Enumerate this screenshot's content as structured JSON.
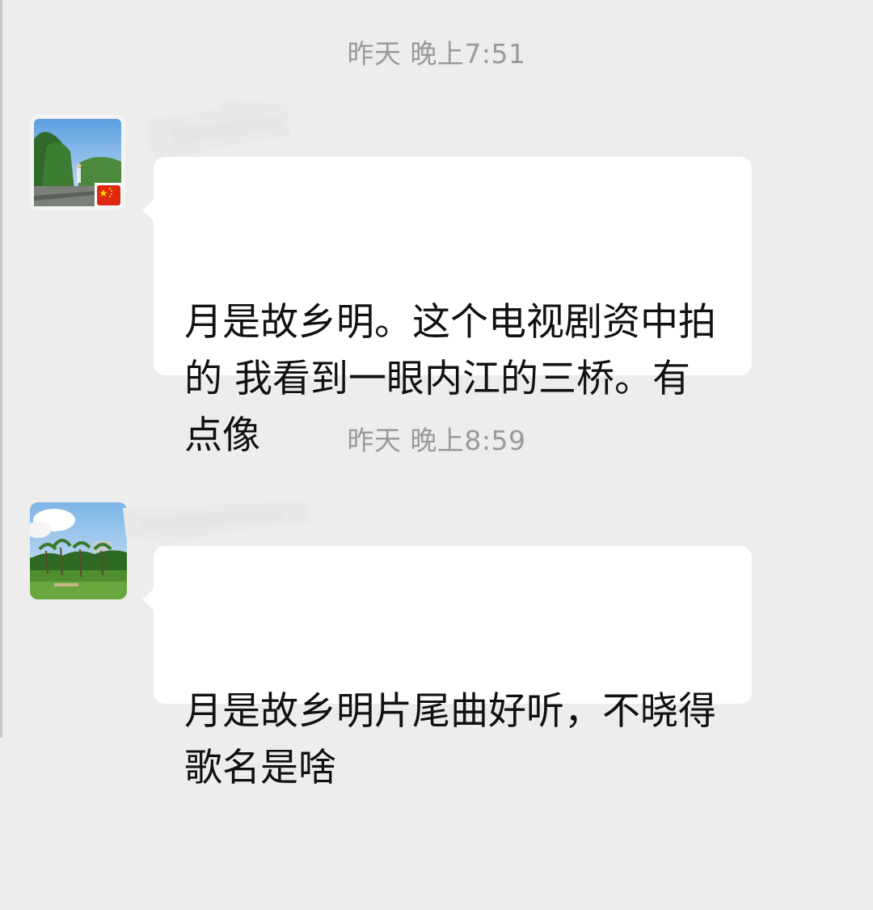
{
  "messages": [
    {
      "timestamp": "昨天 晚上7:51",
      "text": "月是故乡明。这个电视剧资中拍的 我看到一眼内江的三桥。有点像",
      "avatar_icon": "avatar-park-road-photo-with-china-flag"
    },
    {
      "timestamp": "昨天 晚上8:59",
      "text": "月是故乡明片尾曲好听，不晓得歌名是啥",
      "avatar_icon": "avatar-park-lawn-photo"
    }
  ],
  "colors": {
    "background": "#ededed",
    "bubble": "#ffffff",
    "timestamp_text": "#9a9a9a",
    "message_text": "#111111"
  }
}
